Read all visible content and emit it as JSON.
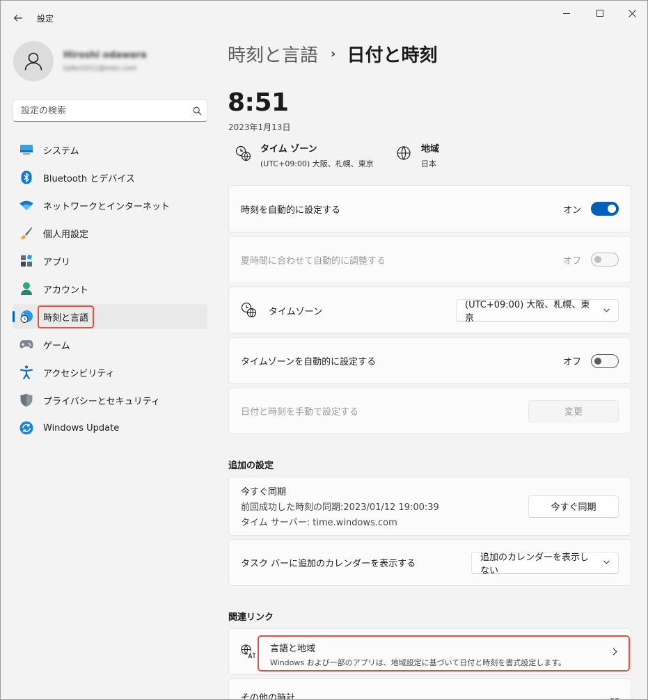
{
  "window": {
    "title": "設定"
  },
  "profile": {
    "name": "Hiroshi odawara",
    "email": "taiko1011@msn.com"
  },
  "search": {
    "placeholder": "設定の検索"
  },
  "sidebar": {
    "items": [
      {
        "label": "システム",
        "icon": "system-icon"
      },
      {
        "label": "Bluetooth とデバイス",
        "icon": "bluetooth-icon"
      },
      {
        "label": "ネットワークとインターネット",
        "icon": "wifi-icon"
      },
      {
        "label": "個人用設定",
        "icon": "brush-icon"
      },
      {
        "label": "アプリ",
        "icon": "apps-icon"
      },
      {
        "label": "アカウント",
        "icon": "account-icon"
      },
      {
        "label": "時刻と言語",
        "icon": "time-language-icon",
        "selected": true
      },
      {
        "label": "ゲーム",
        "icon": "gamepad-icon"
      },
      {
        "label": "アクセシビリティ",
        "icon": "accessibility-icon"
      },
      {
        "label": "プライバシーとセキュリティ",
        "icon": "shield-icon"
      },
      {
        "label": "Windows Update",
        "icon": "update-icon"
      }
    ]
  },
  "breadcrumb": {
    "parent": "時刻と言語",
    "separator": "›",
    "current": "日付と時刻"
  },
  "clock": {
    "time": "8:51",
    "date": "2023年1月13日"
  },
  "timezone_info": {
    "title": "タイム ゾーン",
    "value": "(UTC+09:00) 大阪、札幌、東京"
  },
  "region_info": {
    "title": "地域",
    "value": "日本"
  },
  "settings": {
    "auto_time": {
      "label": "時刻を自動的に設定する",
      "state": "オン"
    },
    "dst": {
      "label": "夏時間に合わせて自動的に調整する",
      "state": "オフ"
    },
    "timezone": {
      "label": "タイムゾーン",
      "value": "(UTC+09:00) 大阪、札幌、東京"
    },
    "auto_timezone": {
      "label": "タイムゾーンを自動的に設定する",
      "state": "オフ"
    },
    "manual": {
      "label": "日付と時刻を手動で設定する",
      "button": "変更"
    }
  },
  "additional": {
    "title": "追加の設定",
    "sync": {
      "title": "今すぐ同期",
      "last": "前回成功した時刻の同期:2023/01/12 19:00:39",
      "server": "タイム サーバー: time.windows.com",
      "button": "今すぐ同期"
    },
    "calendar": {
      "label": "タスク バーに追加のカレンダーを表示する",
      "value": "追加のカレンダーを表示しない"
    }
  },
  "related": {
    "title": "関連リンク",
    "language_region": {
      "title": "言語と地域",
      "subtitle": "Windows および一部のアプリは、地域設定に基づいて日付と時刻を書式設定します。"
    },
    "other_clocks": {
      "title": "その他の時計"
    }
  },
  "colors": {
    "accent": "#005fb8",
    "highlight": "#e0533d"
  }
}
